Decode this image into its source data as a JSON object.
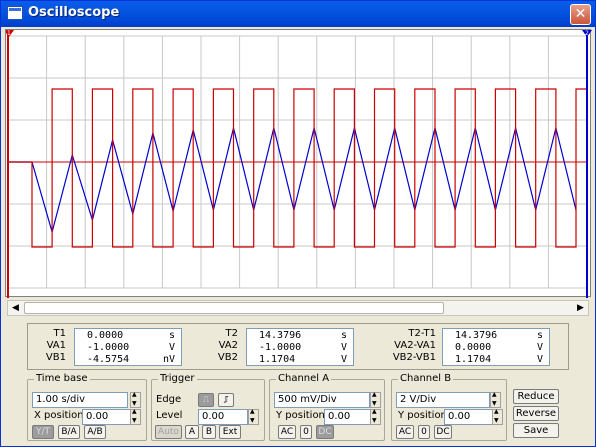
{
  "window": {
    "title": "Oscilloscope",
    "close_label": "✕"
  },
  "colors": {
    "grid": "#c8c8c8",
    "channel_a": "#0000cc",
    "channel_b": "#cc0000",
    "title_bar": "#0454e0"
  },
  "cursors": {
    "t1_marker": "1",
    "t2_marker": "2"
  },
  "readout": {
    "t1": {
      "labels": [
        "T1",
        "VA1",
        "VB1"
      ],
      "values": [
        [
          "0.0000",
          "s"
        ],
        [
          "-1.0000",
          "V"
        ],
        [
          "-4.5754",
          "nV"
        ]
      ]
    },
    "t2": {
      "labels": [
        "T2",
        "VA2",
        "VB2"
      ],
      "values": [
        [
          "14.3796",
          "s"
        ],
        [
          "-1.0000",
          "V"
        ],
        [
          "1.1704",
          "V"
        ]
      ]
    },
    "diff": {
      "labels": [
        "T2-T1",
        "VA2-VA1",
        "VB2-VB1"
      ],
      "values": [
        [
          "14.3796",
          "s"
        ],
        [
          "0.0000",
          "V"
        ],
        [
          "1.1704",
          "V"
        ]
      ]
    }
  },
  "timebase": {
    "title": "Time base",
    "scale": "1.00 s/div",
    "xpos_label": "X position",
    "xpos": "0.00",
    "modes": [
      "Y/T",
      "B/A",
      "A/B"
    ]
  },
  "trigger": {
    "title": "Trigger",
    "edge_label": "Edge",
    "level_label": "Level",
    "level": "0.00",
    "sources": [
      "Auto",
      "A",
      "B",
      "Ext"
    ]
  },
  "channel_a": {
    "title": "Channel A",
    "scale": "500 mV/Div",
    "ypos_label": "Y position",
    "ypos": "0.00",
    "coupling": [
      "AC",
      "0",
      "DC"
    ]
  },
  "channel_b": {
    "title": "Channel B",
    "scale": "2 V/Div",
    "ypos_label": "Y position",
    "ypos": "0.00",
    "coupling": [
      "AC",
      "0",
      "DC"
    ]
  },
  "actions": {
    "reduce": "Reduce",
    "reverse": "Reverse",
    "save": "Save"
  },
  "scrollbar": {
    "left": "◀",
    "right": "▶"
  }
}
